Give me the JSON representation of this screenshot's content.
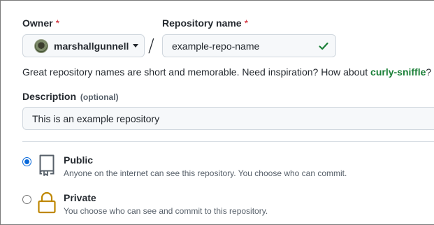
{
  "owner": {
    "label": "Owner",
    "required_marker": "*",
    "username": "marshallgunnell"
  },
  "repository": {
    "label": "Repository name",
    "required_marker": "*",
    "value": "example-repo-name",
    "valid": true
  },
  "separator": "/",
  "hint": {
    "text": "Great repository names are short and memorable. Need inspiration? How about ",
    "suggestion": "curly-sniffle",
    "suffix": "?"
  },
  "description": {
    "label": "Description",
    "optional_label": "(optional)",
    "value": "This is an example repository"
  },
  "visibility": {
    "options": [
      {
        "title": "Public",
        "description": "Anyone on the internet can see this repository. You choose who can commit.",
        "selected": true,
        "icon": "repo-icon"
      },
      {
        "title": "Private",
        "description": "You choose who can see and commit to this repository.",
        "selected": false,
        "icon": "lock-icon"
      }
    ]
  },
  "colors": {
    "required": "#cf222e",
    "success": "#1a7f37",
    "accent": "#0969da",
    "lock": "#bf8700"
  }
}
